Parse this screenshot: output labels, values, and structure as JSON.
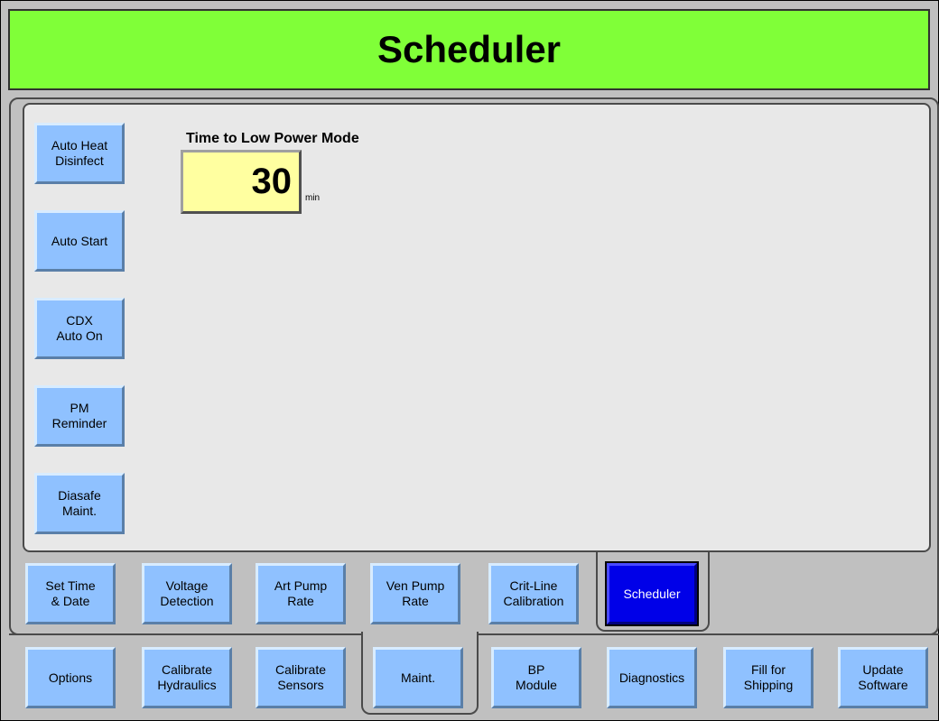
{
  "header": {
    "title": "Scheduler"
  },
  "side_buttons": [
    {
      "label": "Auto Heat\nDisinfect"
    },
    {
      "label": "Auto Start"
    },
    {
      "label": "CDX\nAuto On"
    },
    {
      "label": "PM\nReminder"
    },
    {
      "label": "Diasafe\nMaint."
    }
  ],
  "low_power": {
    "label": "Time to Low Power Mode",
    "value": "30",
    "unit": "min"
  },
  "sub_tabs": [
    {
      "label": "Set Time\n& Date"
    },
    {
      "label": "Voltage\nDetection"
    },
    {
      "label": "Art Pump\nRate"
    },
    {
      "label": "Ven Pump\nRate"
    },
    {
      "label": "Crit-Line\nCalibration"
    },
    {
      "label": "Scheduler",
      "active": true
    }
  ],
  "main_tabs": [
    {
      "label": "Options"
    },
    {
      "label": "Calibrate\nHydraulics"
    },
    {
      "label": "Calibrate\nSensors"
    },
    {
      "label": "Maint.",
      "active": true
    },
    {
      "label": "BP\nModule"
    },
    {
      "label": "Diagnostics"
    },
    {
      "label": "Fill for\nShipping"
    },
    {
      "label": "Update\nSoftware"
    }
  ],
  "colors": {
    "title_bg": "#80ff38",
    "button": "#8fc1ff",
    "active_button": "#0000e8",
    "value_field": "#ffffa0"
  }
}
